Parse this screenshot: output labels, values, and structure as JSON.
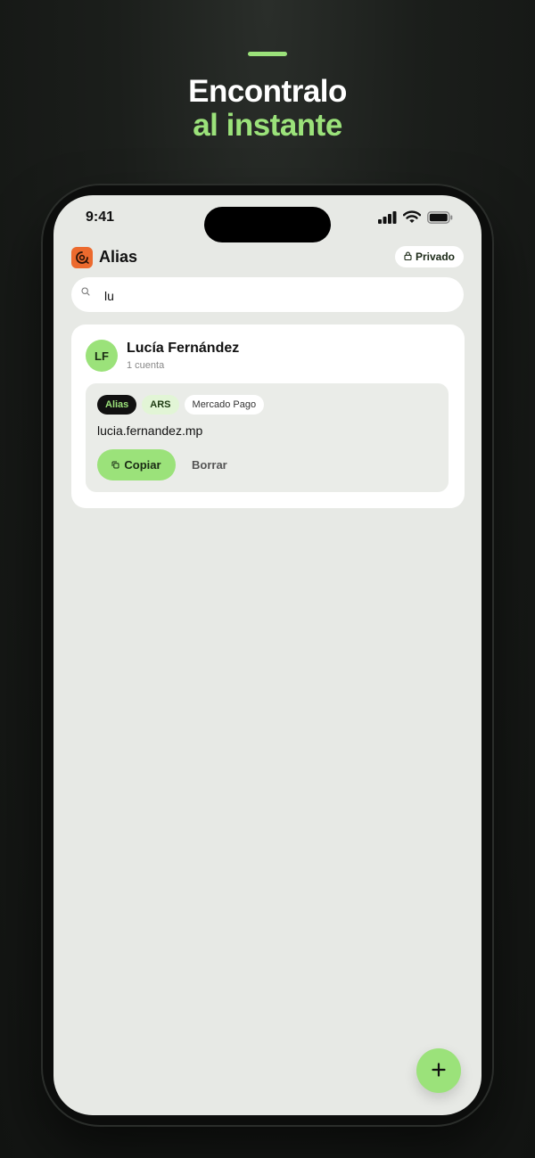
{
  "promo": {
    "headline_line1": "Encontralo",
    "headline_line2": "al instante"
  },
  "status_bar": {
    "time": "9:41",
    "icons": [
      "signal-icon",
      "wifi-icon",
      "battery-icon"
    ]
  },
  "app": {
    "title": "Alias",
    "logo_icon": "app-logo-icon",
    "privacy_badge": "Privado"
  },
  "search": {
    "value": "lu",
    "icon": "search-icon"
  },
  "results": [
    {
      "initials": "LF",
      "name": "Lucía Fernández",
      "subtitle": "1 cuenta",
      "accounts": [
        {
          "tags": [
            "Alias",
            "ARS",
            "Mercado Pago"
          ],
          "value": "lucia.fernandez.mp",
          "copy_label": "Copiar",
          "delete_label": "Borrar"
        }
      ]
    }
  ],
  "fab": {
    "icon": "plus-icon"
  },
  "colors": {
    "accent": "#9be27a",
    "logo": "#ec6a2e",
    "screen_bg": "#e7e9e5",
    "page_bg": "#151715"
  }
}
